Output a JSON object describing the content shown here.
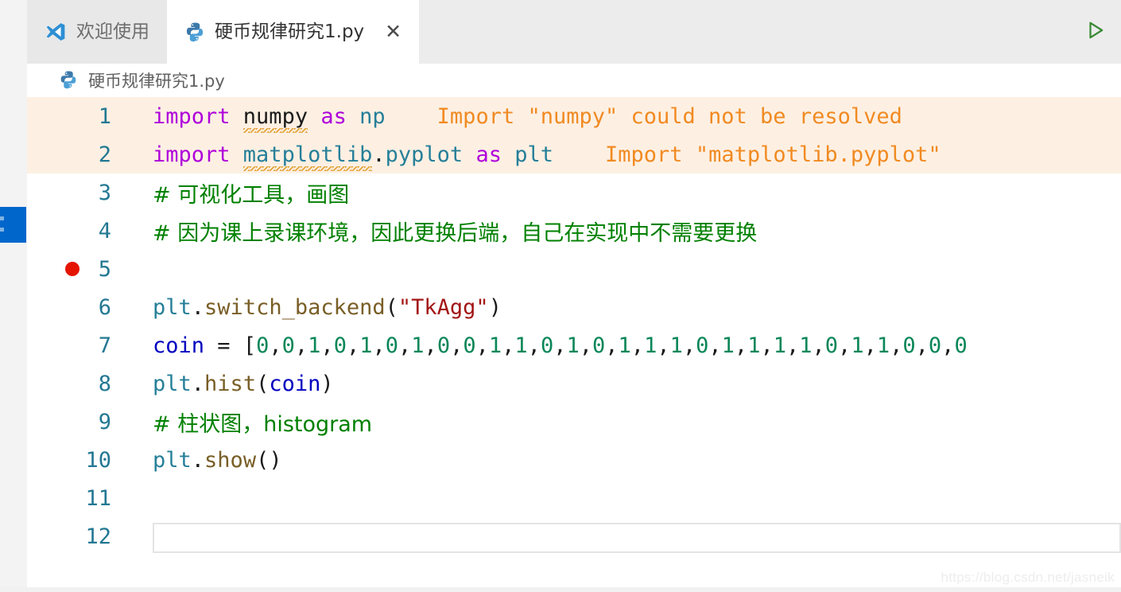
{
  "window": {
    "run_button_icon": "play-triangle-icon"
  },
  "tabs": [
    {
      "label": "欢迎使用",
      "icon": "vscode-logo-icon",
      "active": false,
      "closable": false
    },
    {
      "label": "硬币规律研究1.py",
      "icon": "python-file-icon",
      "active": true,
      "closable": true,
      "close_label": "✕"
    }
  ],
  "breadcrumb": {
    "icon": "python-file-icon",
    "label": "硬币规律研究1.py"
  },
  "editor": {
    "lines": [
      {
        "number": "1",
        "warn_background": true,
        "breakpoint": false,
        "tokens": [
          {
            "text": "import ",
            "cls": "kw"
          },
          {
            "text": "numpy",
            "cls": "ident squiggle"
          },
          {
            "text": " ",
            "cls": "punc"
          },
          {
            "text": "as",
            "cls": "kw"
          },
          {
            "text": " ",
            "cls": "punc"
          },
          {
            "text": "np",
            "cls": "mod"
          },
          {
            "text": "    ",
            "cls": "punc"
          },
          {
            "text": "Import \"numpy\" could not be resolved",
            "cls": "warntext"
          }
        ]
      },
      {
        "number": "2",
        "warn_background": true,
        "breakpoint": false,
        "tokens": [
          {
            "text": "import ",
            "cls": "kw"
          },
          {
            "text": "matplotlib",
            "cls": "mod squiggle"
          },
          {
            "text": ".",
            "cls": "dot"
          },
          {
            "text": "pyplot",
            "cls": "mod"
          },
          {
            "text": " ",
            "cls": "punc"
          },
          {
            "text": "as",
            "cls": "kw"
          },
          {
            "text": " ",
            "cls": "punc"
          },
          {
            "text": "plt",
            "cls": "mod"
          },
          {
            "text": "    ",
            "cls": "punc"
          },
          {
            "text": "Import \"matplotlib.pyplot\"",
            "cls": "warntext"
          }
        ]
      },
      {
        "number": "3",
        "warn_background": false,
        "breakpoint": false,
        "tokens": [
          {
            "text": "# 可视化工具，画图",
            "cls": "cmt cn"
          }
        ]
      },
      {
        "number": "4",
        "warn_background": false,
        "breakpoint": false,
        "tokens": [
          {
            "text": "# 因为课上录课环境，因此更换后端，自己在实现中不需要更换",
            "cls": "cmt cn"
          }
        ]
      },
      {
        "number": "5",
        "warn_background": false,
        "breakpoint": true,
        "tokens": []
      },
      {
        "number": "6",
        "warn_background": false,
        "breakpoint": false,
        "tokens": [
          {
            "text": "plt",
            "cls": "mod"
          },
          {
            "text": ".",
            "cls": "dot"
          },
          {
            "text": "switch_backend",
            "cls": "fn"
          },
          {
            "text": "(",
            "cls": "punc"
          },
          {
            "text": "\"TkAgg\"",
            "cls": "str"
          },
          {
            "text": ")",
            "cls": "punc"
          }
        ]
      },
      {
        "number": "7",
        "warn_background": false,
        "breakpoint": false,
        "tokens": [
          {
            "text": "coin",
            "cls": "var"
          },
          {
            "text": " ",
            "cls": "punc"
          },
          {
            "text": "=",
            "cls": "punc"
          },
          {
            "text": " ",
            "cls": "punc"
          },
          {
            "text": "[",
            "cls": "punc"
          },
          {
            "text": "0",
            "cls": "num"
          },
          {
            "text": ",",
            "cls": "punc"
          },
          {
            "text": "0",
            "cls": "num"
          },
          {
            "text": ",",
            "cls": "punc"
          },
          {
            "text": "1",
            "cls": "num"
          },
          {
            "text": ",",
            "cls": "punc"
          },
          {
            "text": "0",
            "cls": "num"
          },
          {
            "text": ",",
            "cls": "punc"
          },
          {
            "text": "1",
            "cls": "num"
          },
          {
            "text": ",",
            "cls": "punc"
          },
          {
            "text": "0",
            "cls": "num"
          },
          {
            "text": ",",
            "cls": "punc"
          },
          {
            "text": "1",
            "cls": "num"
          },
          {
            "text": ",",
            "cls": "punc"
          },
          {
            "text": "0",
            "cls": "num"
          },
          {
            "text": ",",
            "cls": "punc"
          },
          {
            "text": "0",
            "cls": "num"
          },
          {
            "text": ",",
            "cls": "punc"
          },
          {
            "text": "1",
            "cls": "num"
          },
          {
            "text": ",",
            "cls": "punc"
          },
          {
            "text": "1",
            "cls": "num"
          },
          {
            "text": ",",
            "cls": "punc"
          },
          {
            "text": "0",
            "cls": "num"
          },
          {
            "text": ",",
            "cls": "punc"
          },
          {
            "text": "1",
            "cls": "num"
          },
          {
            "text": ",",
            "cls": "punc"
          },
          {
            "text": "0",
            "cls": "num"
          },
          {
            "text": ",",
            "cls": "punc"
          },
          {
            "text": "1",
            "cls": "num"
          },
          {
            "text": ",",
            "cls": "punc"
          },
          {
            "text": "1",
            "cls": "num"
          },
          {
            "text": ",",
            "cls": "punc"
          },
          {
            "text": "1",
            "cls": "num"
          },
          {
            "text": ",",
            "cls": "punc"
          },
          {
            "text": "0",
            "cls": "num"
          },
          {
            "text": ",",
            "cls": "punc"
          },
          {
            "text": "1",
            "cls": "num"
          },
          {
            "text": ",",
            "cls": "punc"
          },
          {
            "text": "1",
            "cls": "num"
          },
          {
            "text": ",",
            "cls": "punc"
          },
          {
            "text": "1",
            "cls": "num"
          },
          {
            "text": ",",
            "cls": "punc"
          },
          {
            "text": "1",
            "cls": "num"
          },
          {
            "text": ",",
            "cls": "punc"
          },
          {
            "text": "0",
            "cls": "num"
          },
          {
            "text": ",",
            "cls": "punc"
          },
          {
            "text": "1",
            "cls": "num"
          },
          {
            "text": ",",
            "cls": "punc"
          },
          {
            "text": "1",
            "cls": "num"
          },
          {
            "text": ",",
            "cls": "punc"
          },
          {
            "text": "0",
            "cls": "num"
          },
          {
            "text": ",",
            "cls": "punc"
          },
          {
            "text": "0",
            "cls": "num"
          },
          {
            "text": ",",
            "cls": "punc"
          },
          {
            "text": "0",
            "cls": "num"
          }
        ]
      },
      {
        "number": "8",
        "warn_background": false,
        "breakpoint": false,
        "tokens": [
          {
            "text": "plt",
            "cls": "mod"
          },
          {
            "text": ".",
            "cls": "dot"
          },
          {
            "text": "hist",
            "cls": "fn"
          },
          {
            "text": "(",
            "cls": "punc"
          },
          {
            "text": "coin",
            "cls": "var"
          },
          {
            "text": ")",
            "cls": "punc"
          }
        ]
      },
      {
        "number": "9",
        "warn_background": false,
        "breakpoint": false,
        "tokens": [
          {
            "text": "# 柱状图，histogram",
            "cls": "cmt cn"
          }
        ]
      },
      {
        "number": "10",
        "warn_background": false,
        "breakpoint": false,
        "tokens": [
          {
            "text": "plt",
            "cls": "mod"
          },
          {
            "text": ".",
            "cls": "dot"
          },
          {
            "text": "show",
            "cls": "fn"
          },
          {
            "text": "(",
            "cls": "punc"
          },
          {
            "text": ")",
            "cls": "punc"
          }
        ]
      },
      {
        "number": "11",
        "warn_background": false,
        "breakpoint": false,
        "tokens": []
      },
      {
        "number": "12",
        "warn_background": false,
        "breakpoint": false,
        "input_box": true,
        "tokens": []
      }
    ]
  },
  "watermark": {
    "text": "https://blog.csdn.net/jasneik"
  },
  "colors": {
    "keyword": "#af00db",
    "module": "#267f99",
    "function": "#795e26",
    "string": "#a31515",
    "number": "#098658",
    "variable": "#0000c0",
    "comment": "#008000",
    "diagnostic": "#f18a21",
    "diagnostic_bg": "#fdf0e3",
    "line_number": "#237893",
    "breakpoint": "#e51400",
    "accent_blue": "#0066cc",
    "run_green": "#3a8a35"
  }
}
